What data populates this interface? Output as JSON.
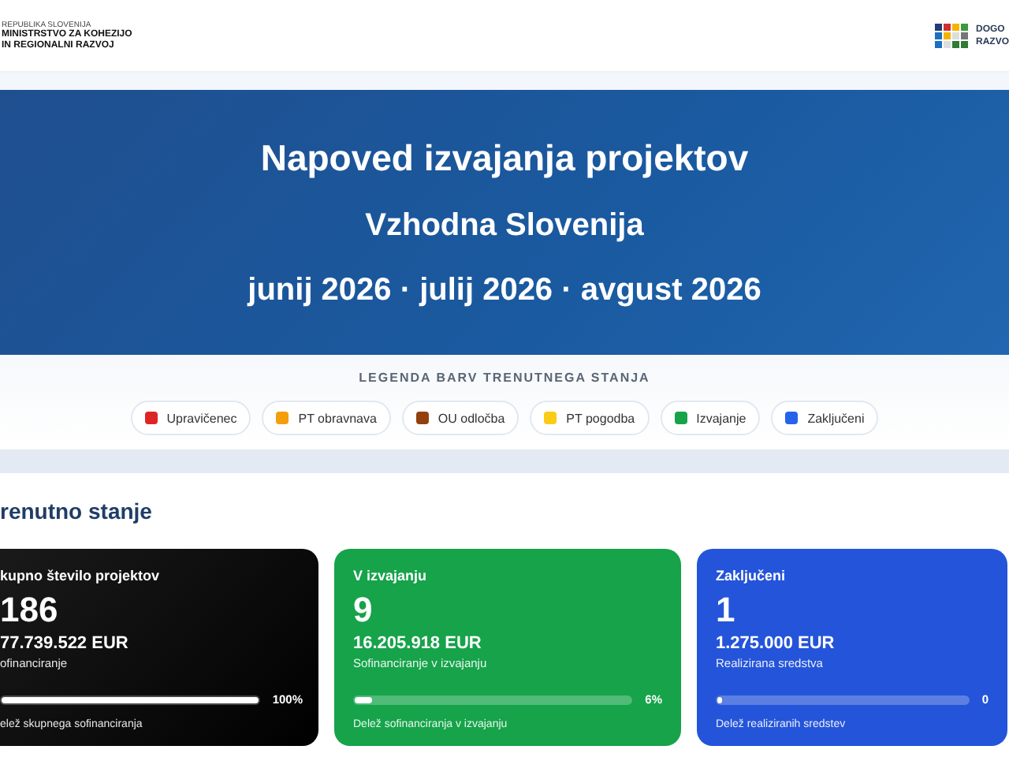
{
  "header": {
    "left_logo": {
      "top_line": "REPUBLIKA SLOVENIJA",
      "name_lines": [
        "MINISTRSTVO ZA KOHEZIJO",
        "IN REGIONALNI RAZVOJ"
      ]
    },
    "right_logo": {
      "lines": [
        "DOGO",
        "RAZVO"
      ]
    }
  },
  "hero": {
    "title": "Napoved izvajanja projektov",
    "region": "Vzhodna Slovenija",
    "months": "junij 2026 · julij 2026 · avgust 2026"
  },
  "legend": {
    "title": "LEGENDA BARV TRENUTNEGA STANJA",
    "items": [
      {
        "label": "Upravičenec",
        "color": "#dc2626"
      },
      {
        "label": "PT obravnava",
        "color": "#f59e0b"
      },
      {
        "label": "OU odločba",
        "color": "#92400e"
      },
      {
        "label": "PT pogodba",
        "color": "#facc15"
      },
      {
        "label": "Izvajanje",
        "color": "#16a34a"
      },
      {
        "label": "Zaključeni",
        "color": "#2563eb"
      }
    ]
  },
  "section": {
    "title": "renutno stanje"
  },
  "cards": [
    {
      "kind": "dark",
      "title": "kupno število projektov",
      "count": "186",
      "amount": "77.739.522 EUR",
      "amount_label": "ofinanciranje",
      "level": 1,
      "percent": "100%",
      "bar_label": "elež skupnega sofinanciranja"
    },
    {
      "kind": "green",
      "title": "V izvajanju",
      "count": "9",
      "amount": "16.205.918 EUR",
      "amount_label": "Sofinanciranje v izvajanju",
      "level": 0.06,
      "percent": "6%",
      "bar_label": "Delež sofinanciranja v izvajanju"
    },
    {
      "kind": "blue",
      "title": "Zaključeni",
      "count": "1",
      "amount": "1.275.000 EUR",
      "amount_label": "Realizirana sredstva",
      "level": 0.02,
      "percent": "0",
      "bar_label": "Delež realiziranih sredstev"
    }
  ]
}
